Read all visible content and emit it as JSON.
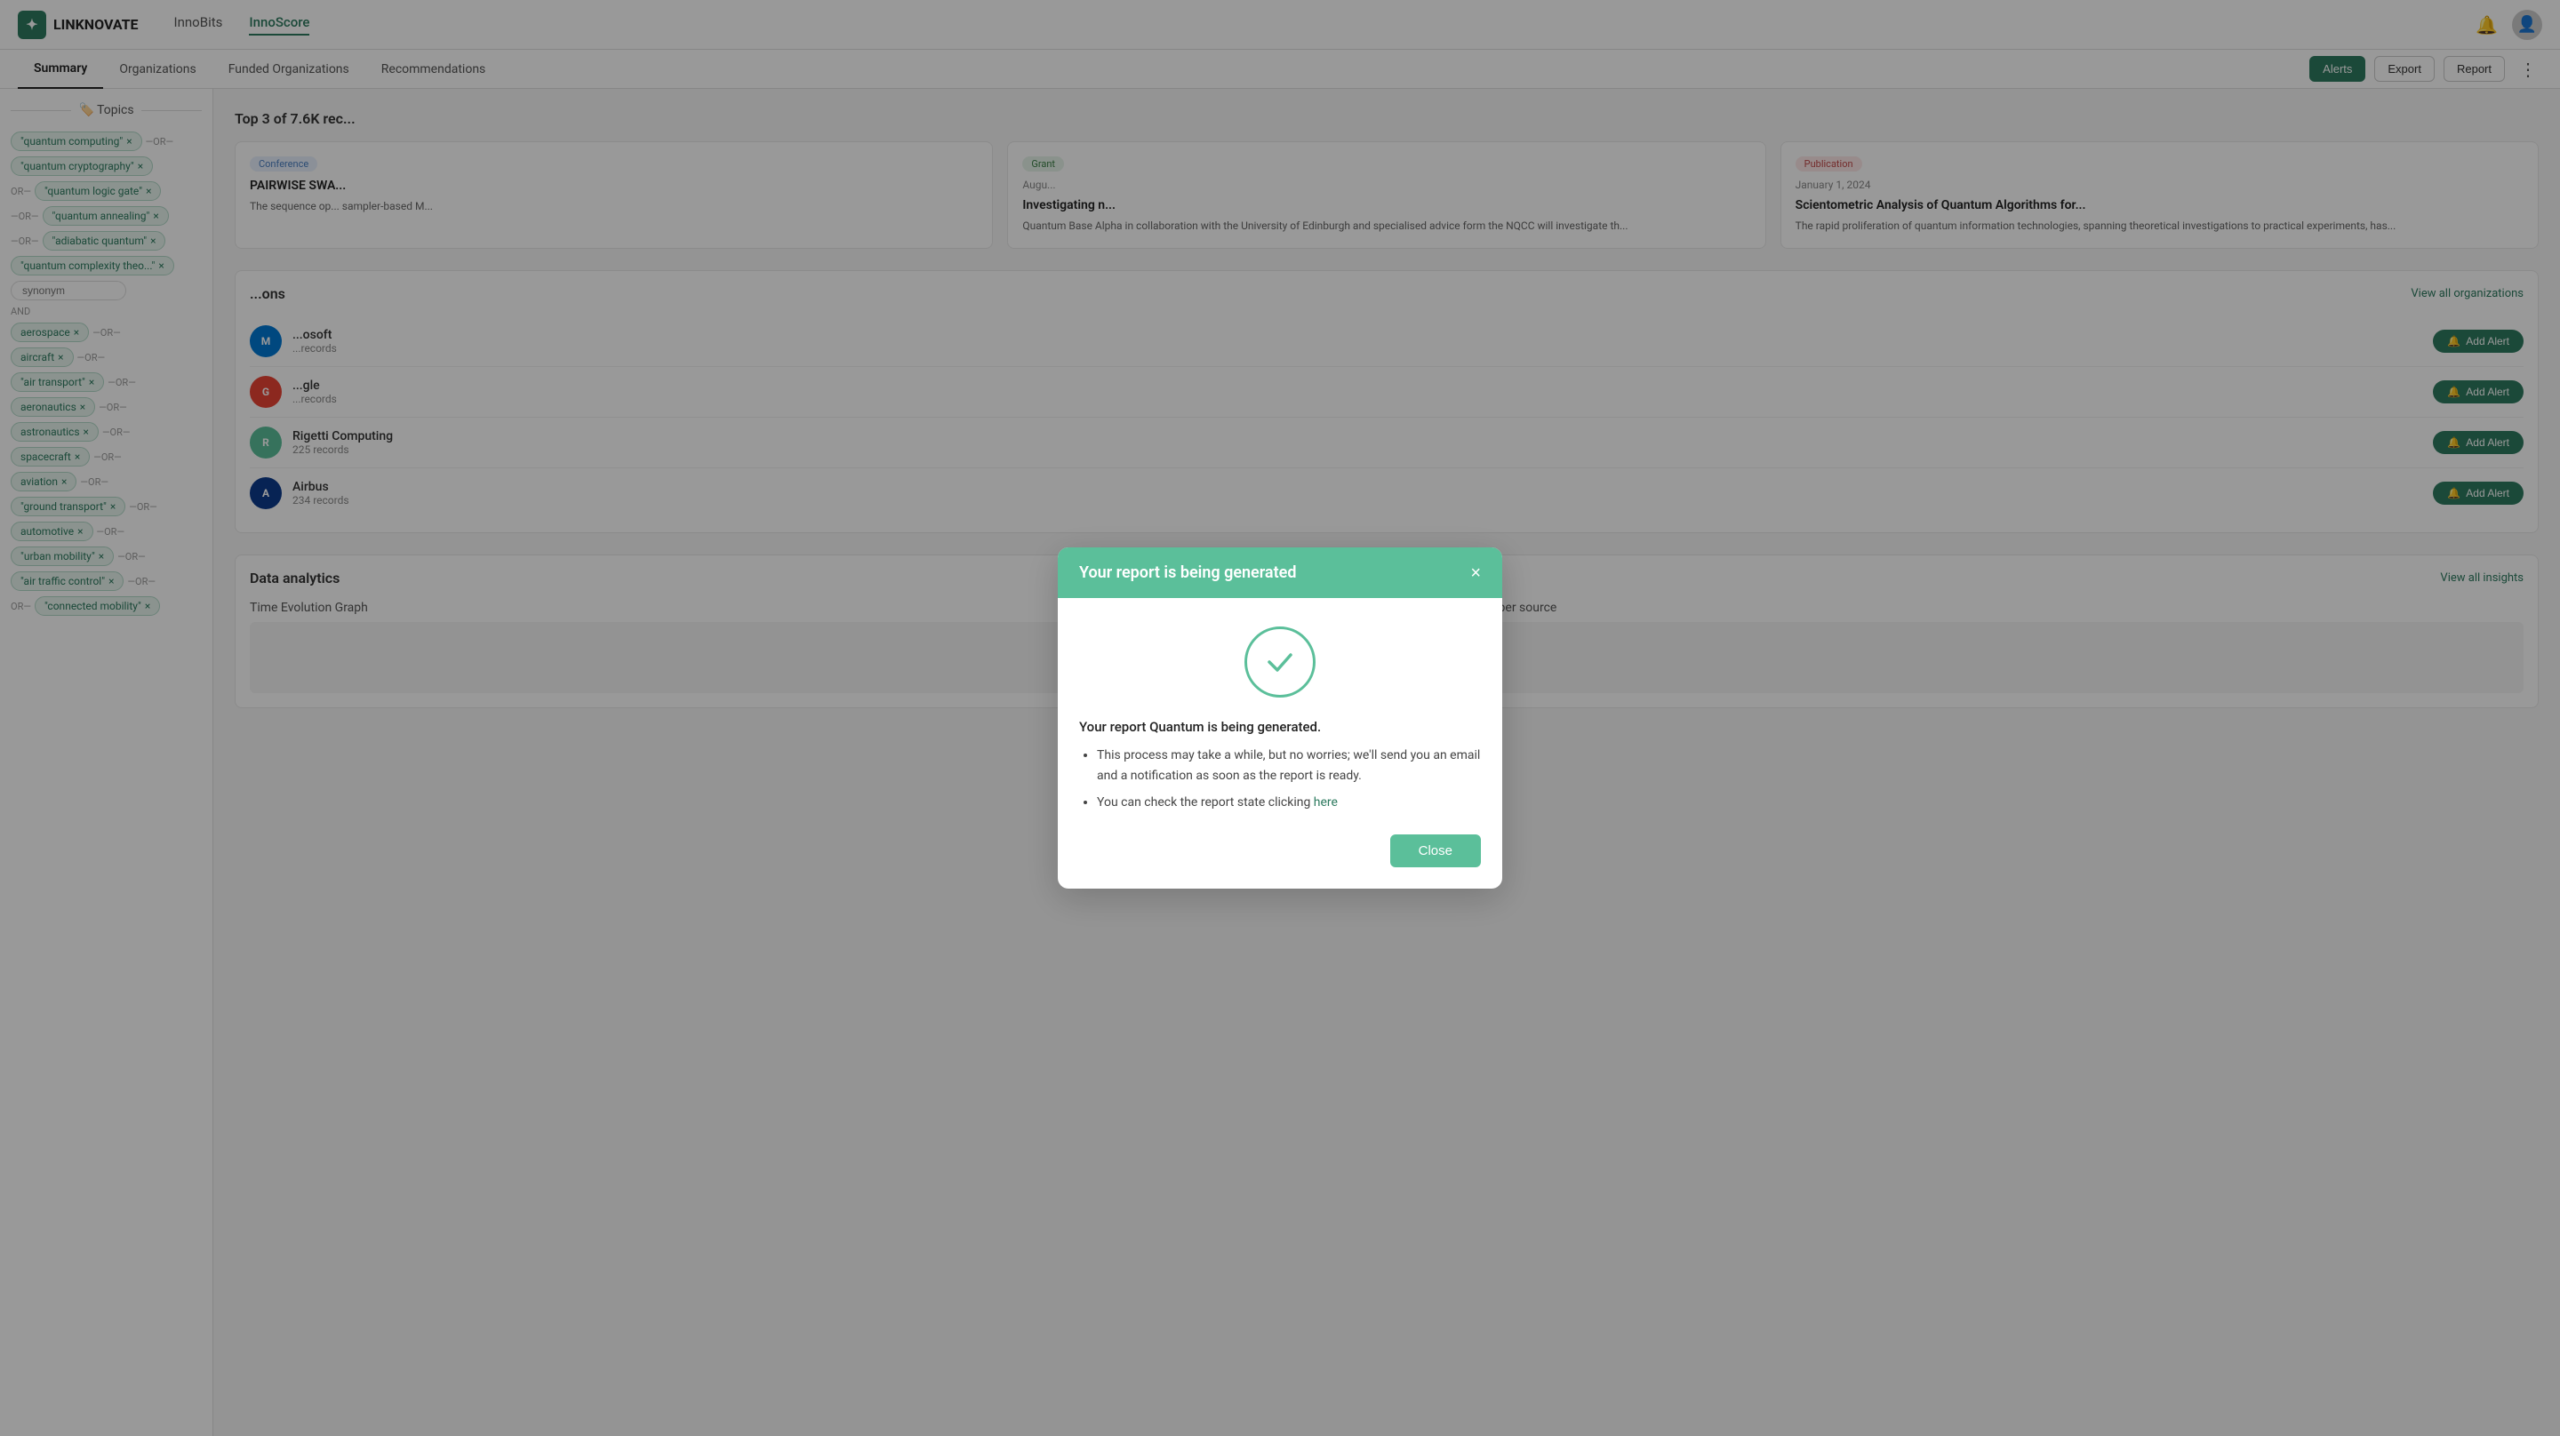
{
  "nav": {
    "logo": "LINKNOVATE",
    "tabs": [
      {
        "label": "InnoBits",
        "active": false
      },
      {
        "label": "InnoScore",
        "active": true
      }
    ],
    "sub_tabs": [
      {
        "label": "Summary",
        "active": true
      },
      {
        "label": "Organizations",
        "active": false
      },
      {
        "label": "Funded Organizations",
        "active": false
      },
      {
        "label": "Recommendations",
        "active": false
      }
    ],
    "alerts_btn": "Alerts",
    "export_btn": "Export",
    "report_btn": "Report"
  },
  "sidebar": {
    "topics_label": "Topics",
    "tags_group1": [
      {
        "text": "\"quantum computing\""
      },
      {
        "text": "\"quantum cryptography\""
      },
      {
        "text": "\"quantum logic gate\""
      },
      {
        "text": "\"quantum annealing\""
      },
      {
        "text": "\"adiabatic quantum\""
      },
      {
        "text": "\"quantum complexity theo...\""
      }
    ],
    "synonym_placeholder": "synonym",
    "tags_group2": [
      {
        "text": "aerospace"
      },
      {
        "text": "aircraft"
      },
      {
        "text": "\"air transport\""
      },
      {
        "text": "aeronautics"
      },
      {
        "text": "astronautics"
      },
      {
        "text": "spacecraft"
      },
      {
        "text": "aviation"
      },
      {
        "text": "\"ground transport\""
      },
      {
        "text": "automotive"
      },
      {
        "text": "\"urban mobility\""
      },
      {
        "text": "\"air traffic control\""
      },
      {
        "text": "\"connected mobility\""
      }
    ]
  },
  "main": {
    "records_title": "Top 3 of 7.6K rec...",
    "orgs_title": "...ons",
    "view_all_orgs": "View all organizations",
    "records": [
      {
        "badge": "Conference",
        "badge_type": "conference",
        "title": "PAIRWISE SWA...",
        "text": "The sequence op... sampler-based M..."
      },
      {
        "badge": "Grant",
        "badge_type": "grant",
        "meta": "Augu...",
        "title": "Investigating n...",
        "text": "Quantum Base Alpha in collaboration with the University of Edinburgh and specialised advice form the NQCC will investigate th..."
      },
      {
        "badge": "Publication",
        "badge_type": "publication",
        "meta": "January 1, 2024",
        "title": "Scientometric Analysis of Quantum Algorithms for...",
        "text": "The rapid proliferation of quantum information technologies, spanning theoretical investigations to practical experiments, has..."
      }
    ],
    "organizations": [
      {
        "name": "...osoft",
        "records": "...records",
        "logo_color": "#0078d4",
        "logo_text": "M"
      },
      {
        "name": "...gle",
        "records": "...records",
        "logo_color": "#ea4335",
        "logo_text": "G"
      },
      {
        "name": "Rigetti Computing",
        "records": "225 records",
        "logo_color": "#5bbf9a",
        "logo_text": "R"
      },
      {
        "name": "Airbus",
        "records": "234 records",
        "logo_color": "#0c3b8c",
        "logo_text": "A"
      }
    ],
    "add_alert_label": "Add Alert",
    "analytics_title": "Data analytics",
    "view_all_insights": "View all insights",
    "analytics_cols": [
      {
        "title": "Time Evolution Graph"
      },
      {
        "title": "Weight of records per source"
      }
    ]
  },
  "modal": {
    "title": "Your report is being generated",
    "close_x": "×",
    "main_text": "Your report Quantum is being generated.",
    "bullet1": "This process may take a while, but no worries; we'll send you an email and a notification as soon as the report is ready.",
    "bullet2_prefix": "You can check the report state clicking ",
    "bullet2_link": "here",
    "close_btn": "Close"
  }
}
